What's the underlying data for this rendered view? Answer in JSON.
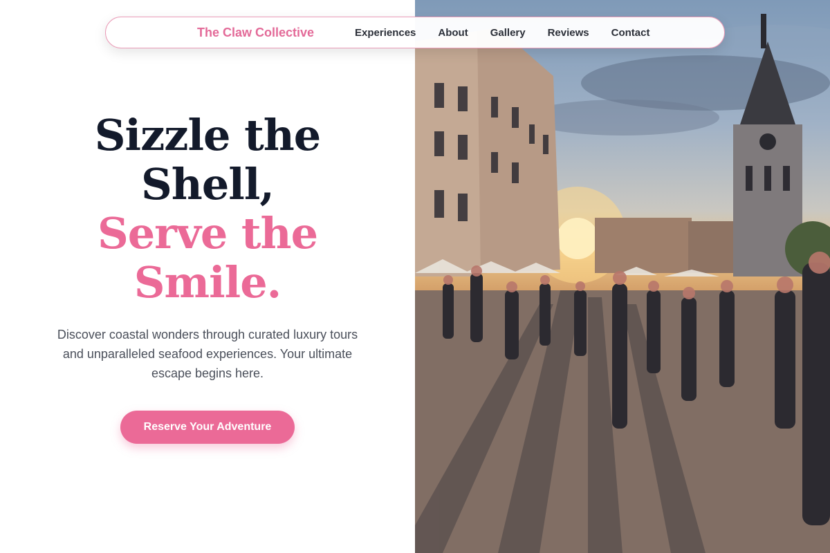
{
  "nav": {
    "brand": "The Claw Collective",
    "links": [
      "Experiences",
      "About",
      "Gallery",
      "Reviews",
      "Contact"
    ]
  },
  "hero": {
    "headline_line1": "Sizzle the",
    "headline_line2": "Shell,",
    "headline_line3": "Serve the",
    "headline_line4": "Smile.",
    "tagline": "Discover coastal wonders through curated luxury tours and unparalleled seafood experiences. Your ultimate escape begins here.",
    "cta_label": "Reserve Your Adventure"
  },
  "colors": {
    "accent_pink": "#eb6a97",
    "headline_dark": "#131a2b",
    "body_text": "#4a4f5a"
  },
  "image": {
    "subject": "busy town square at sunset with clock tower and pedestrians",
    "icon": "hero-photo"
  }
}
